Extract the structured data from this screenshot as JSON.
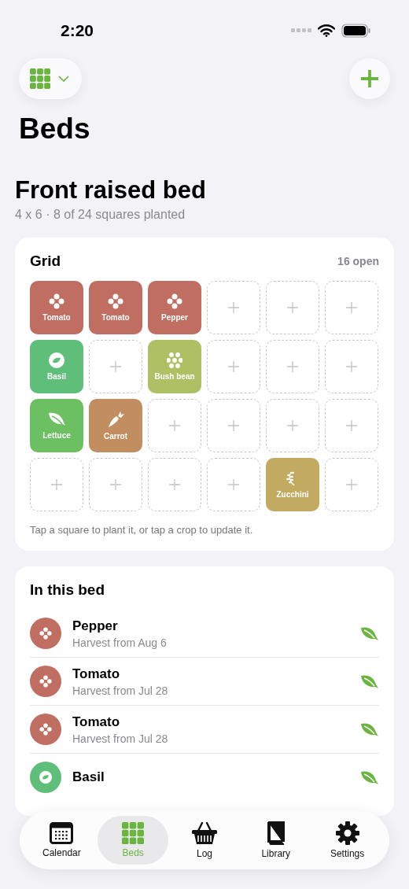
{
  "status_bar": {
    "time": "2:20"
  },
  "page_title": "Beds",
  "bed": {
    "name": "Front raised bed",
    "summary": "4 x 6 · 8 of 24 squares planted"
  },
  "grid": {
    "title": "Grid",
    "open_count": "16 open",
    "hint": "Tap a square to plant it, or tap a crop to update it.",
    "cells": [
      {
        "kind": "fruiting",
        "label": "Tomato",
        "color": "#c06e62"
      },
      {
        "kind": "fruiting",
        "label": "Tomato",
        "color": "#c06e62"
      },
      {
        "kind": "fruiting",
        "label": "Pepper",
        "color": "#c06e62"
      },
      {
        "kind": "empty"
      },
      {
        "kind": "empty"
      },
      {
        "kind": "empty"
      },
      {
        "kind": "herb",
        "label": "Basil",
        "color": "#5fbf7a"
      },
      {
        "kind": "empty"
      },
      {
        "kind": "legume",
        "label": "Bush bean",
        "color": "#adc064"
      },
      {
        "kind": "empty"
      },
      {
        "kind": "empty"
      },
      {
        "kind": "empty"
      },
      {
        "kind": "leafy",
        "label": "Lettuce",
        "color": "#6cc062"
      },
      {
        "kind": "root",
        "label": "Carrot",
        "color": "#c28e5f"
      },
      {
        "kind": "empty"
      },
      {
        "kind": "empty"
      },
      {
        "kind": "empty"
      },
      {
        "kind": "empty"
      },
      {
        "kind": "empty"
      },
      {
        "kind": "empty"
      },
      {
        "kind": "empty"
      },
      {
        "kind": "empty"
      },
      {
        "kind": "vine",
        "label": "Zucchini",
        "color": "#c2aa61"
      },
      {
        "kind": "empty"
      }
    ]
  },
  "crops": {
    "title": "In this bed",
    "items": [
      {
        "kind": "fruiting",
        "name": "Pepper",
        "note": "Harvest from Aug 6",
        "color": "#c06e62"
      },
      {
        "kind": "fruiting",
        "name": "Tomato",
        "note": "Harvest from Jul 28",
        "color": "#c06e62"
      },
      {
        "kind": "fruiting",
        "name": "Tomato",
        "note": "Harvest from Jul 28",
        "color": "#c06e62"
      },
      {
        "kind": "herb",
        "name": "Basil",
        "color": "#5fbf7a"
      }
    ]
  },
  "tabs": [
    {
      "label": "Calendar",
      "selected": false
    },
    {
      "label": "Beds",
      "selected": true
    },
    {
      "label": "Log",
      "selected": false
    },
    {
      "label": "Library",
      "selected": false
    },
    {
      "label": "Settings",
      "selected": false
    }
  ]
}
